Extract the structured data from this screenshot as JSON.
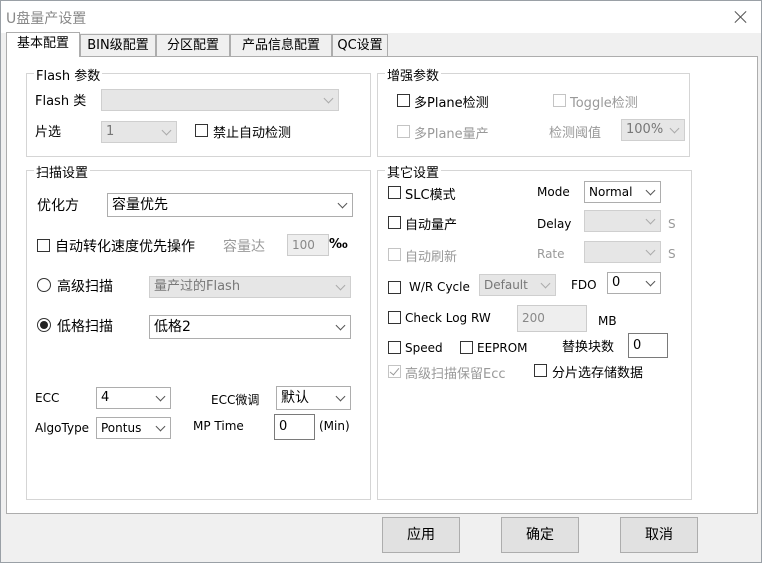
{
  "window": {
    "title": "U盘量产设置"
  },
  "tabs": [
    "基本配置",
    "BIN级配置",
    "分区配置",
    "产品信息配置",
    "QC设置"
  ],
  "flash": {
    "group_label": "Flash 参数",
    "type_label": "Flash 类",
    "chip_label": "片选",
    "chip_value": "1",
    "disable_auto_detect": "禁止自动检测"
  },
  "scan": {
    "group_label": "扫描设置",
    "optimize_label": "优化方",
    "optimize_value": "容量优先",
    "auto_speed_label": "自动转化速度优先操作",
    "capacity_label": "容量达",
    "capacity_value": "100",
    "permille": "‰",
    "advanced_label": "高级扫描",
    "advanced_value": "量产过的Flash",
    "lowgrade_label": "低格扫描",
    "lowgrade_value": "低格2"
  },
  "misc_left": {
    "ecc_label": "ECC",
    "ecc_value": "4",
    "ecc_tune_label": "ECC微调",
    "ecc_tune_value": "默认",
    "algo_label": "AlgoType",
    "algo_value": "Pontus",
    "mptime_label": "MP Time",
    "mptime_value": "0",
    "mptime_unit": "(Min)"
  },
  "enhance": {
    "group_label": "增强参数",
    "multi_plane_detect": "多Plane检测",
    "toggle_detect": "Toggle检测",
    "multi_plane_mass": "多Plane量产",
    "threshold_label": "检测阈值",
    "threshold_value": "100%"
  },
  "other": {
    "group_label": "其它设置",
    "slc_mode": "SLC模式",
    "mode_label": "Mode",
    "mode_value": "Normal",
    "auto_mass": "自动量产",
    "delay_label": "Delay",
    "delay_unit": "S",
    "auto_refresh": "自动刷新",
    "rate_label": "Rate",
    "rate_unit": "S",
    "wr_cycle": "W/R Cycle",
    "wr_value": "Default",
    "fdo_label": "FDO",
    "fdo_value": "0",
    "check_log": "Check Log RW",
    "check_log_value": "200",
    "check_log_unit": "MB",
    "speed": "Speed",
    "eeprom": "EEPROM",
    "replace_label": "替换块数",
    "replace_value": "0",
    "adv_scan_ecc": "高级扫描保留Ecc",
    "split_store": "分片选存储数据"
  },
  "buttons": {
    "apply": "应用",
    "ok": "确定",
    "cancel": "取消"
  }
}
